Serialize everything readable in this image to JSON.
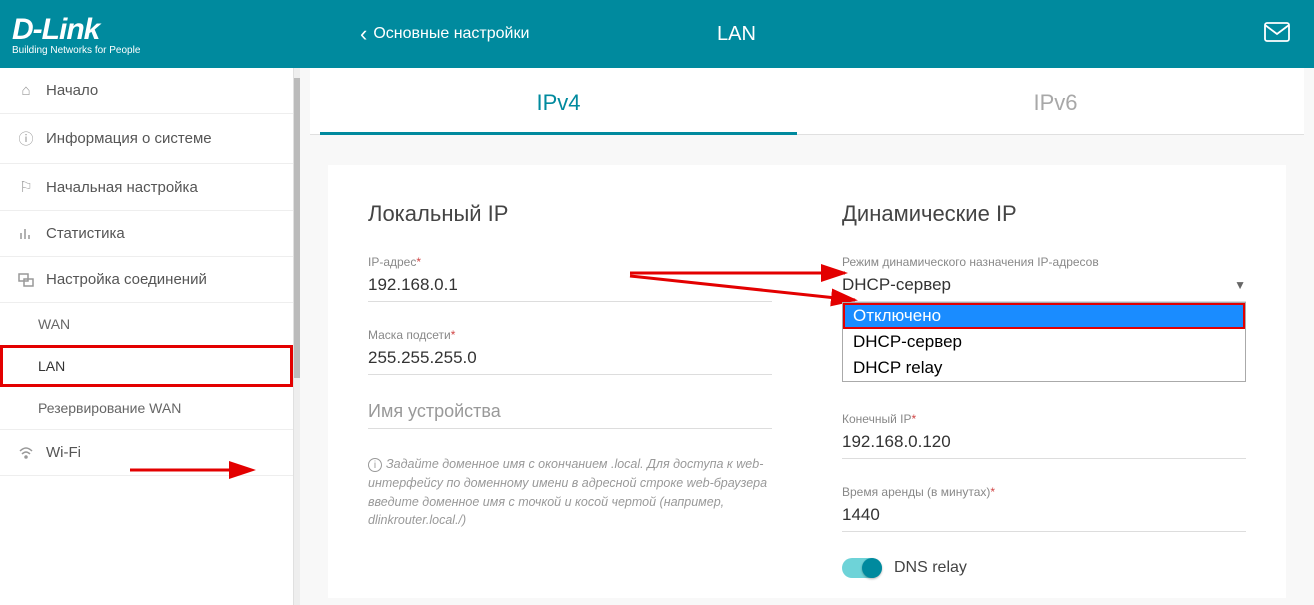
{
  "brand": {
    "name": "D-Link",
    "tagline": "Building Networks for People"
  },
  "header": {
    "back_label": "Основные настройки",
    "page_title": "LAN"
  },
  "sidebar": {
    "items": [
      {
        "label": "Начало"
      },
      {
        "label": "Информация о системе"
      },
      {
        "label": "Начальная настройка"
      },
      {
        "label": "Статистика"
      },
      {
        "label": "Настройка соединений"
      },
      {
        "label": "Wi-Fi"
      }
    ],
    "sub_items": [
      {
        "label": "WAN"
      },
      {
        "label": "LAN"
      },
      {
        "label": "Резервирование WAN"
      }
    ]
  },
  "tabs": {
    "ipv4_label": "IPv4",
    "ipv6_label": "IPv6"
  },
  "local_ip": {
    "title": "Локальный IP",
    "ip_label": "IP-адрес",
    "ip_value": "192.168.0.1",
    "mask_label": "Маска подсети",
    "mask_value": "255.255.255.0",
    "devname_placeholder": "Имя устройства",
    "hint": "Задайте доменное имя с окончанием .local. Для доступа к web-интерфейсу по доменному имени в адресной строке web-браузера введите доменное имя с точкой и косой чертой (например, dlinkrouter.local./)"
  },
  "dynamic_ip": {
    "title": "Динамические IP",
    "mode_label": "Режим динамического назначения IP-адресов",
    "mode_value": "DHCP-сервер",
    "options": [
      {
        "label": "Отключено"
      },
      {
        "label": "DHCP-сервер"
      },
      {
        "label": "DHCP relay"
      }
    ],
    "end_ip_label": "Конечный IP",
    "end_ip_value": "192.168.0.120",
    "lease_label": "Время аренды (в минутах)",
    "lease_value": "1440",
    "dns_relay_label": "DNS relay"
  }
}
